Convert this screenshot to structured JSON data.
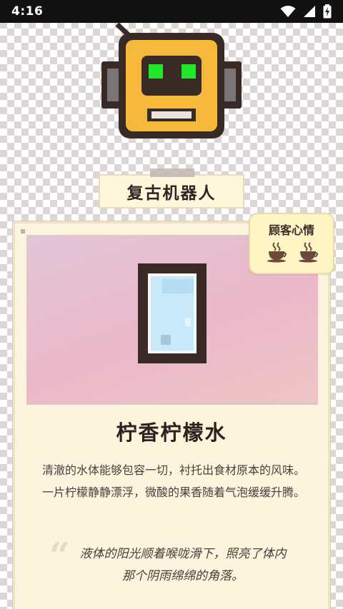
{
  "status_bar": {
    "time": "4:16"
  },
  "robot": {
    "name": "复古机器人"
  },
  "mood": {
    "label": "顾客心情",
    "cups": [
      "coffee-cup-icon",
      "coffee-cup-icon"
    ]
  },
  "drink": {
    "name": "柠香柠檬水",
    "description": "清澈的水体能够包容一切，衬托出食材原本的风味。一片柠檬静静漂浮，微酸的果香随着气泡缓缓升腾。",
    "quote": "液体的阳光顺着喉咙滑下，照亮了体内那个阴雨绵绵的角落。"
  },
  "colors": {
    "robot_yellow": "#f6b93b",
    "robot_eyes": "#22e82a",
    "card_bg": "#fdf4dd",
    "drink_bg": "#ebb8c9",
    "water": "#bfe3f7"
  }
}
